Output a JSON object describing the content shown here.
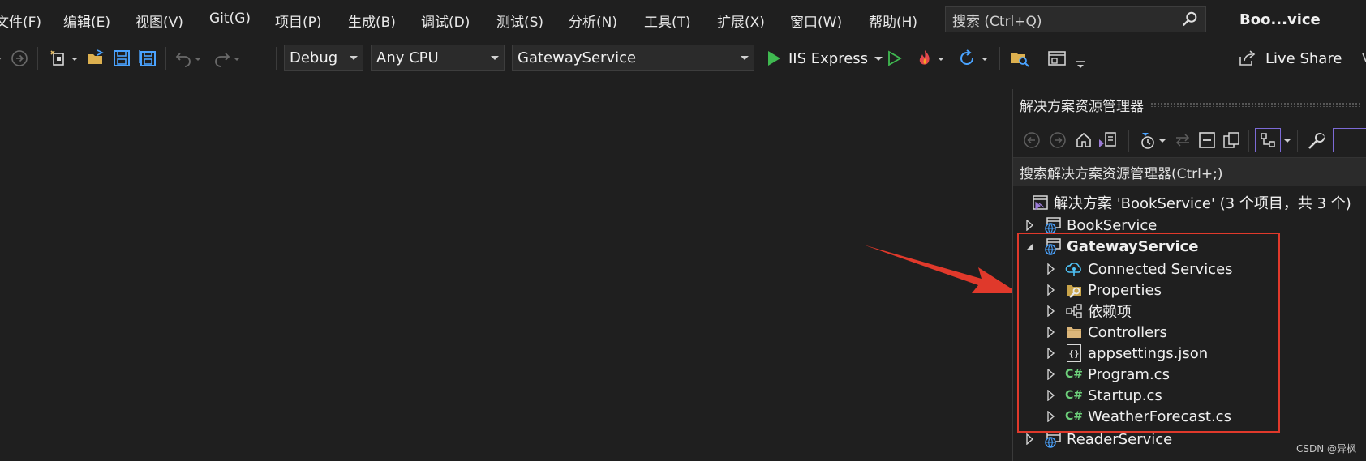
{
  "menu": {
    "items": [
      "文件(F)",
      "编辑(E)",
      "视图(V)",
      "Git(G)",
      "项目(P)",
      "生成(B)",
      "调试(D)",
      "测试(S)",
      "分析(N)",
      "工具(T)",
      "扩展(X)",
      "窗口(W)",
      "帮助(H)"
    ],
    "search_placeholder": "搜索 (Ctrl+Q)",
    "window_title": "Boo...vice"
  },
  "toolbar": {
    "config": "Debug",
    "platform": "Any CPU",
    "startup_project": "GatewayService",
    "run_target": "IIS Express",
    "live_share": "Live Share"
  },
  "solution_explorer": {
    "title": "解决方案资源管理器",
    "search_placeholder": "搜索解决方案资源管理器(Ctrl+;)",
    "solution_label": "解决方案 'BookService' (3 个项目，共 3 个)",
    "nodes": [
      {
        "label": "BookService",
        "icon": "web-project-icon"
      },
      {
        "label": "GatewayService",
        "icon": "web-project-icon"
      },
      {
        "label": "Connected Services",
        "icon": "connected-services-icon"
      },
      {
        "label": "Properties",
        "icon": "properties-icon"
      },
      {
        "label": "依赖项",
        "icon": "dependencies-icon"
      },
      {
        "label": "Controllers",
        "icon": "folder-icon"
      },
      {
        "label": "appsettings.json",
        "icon": "json-file-icon"
      },
      {
        "label": "Program.cs",
        "icon": "csharp-file-icon"
      },
      {
        "label": "Startup.cs",
        "icon": "csharp-file-icon"
      },
      {
        "label": "WeatherForecast.cs",
        "icon": "csharp-file-icon"
      },
      {
        "label": "ReaderService",
        "icon": "web-project-icon"
      }
    ],
    "csharp_badge": "C#",
    "json_badge": "{}"
  },
  "watermark": "CSDN @异枫",
  "colors": {
    "background": "#1f1f1f",
    "highlight_box": "#e0392b",
    "arrow": "#e0392b",
    "play_green": "#3fb950",
    "accent_purple": "#9b7bd6"
  }
}
